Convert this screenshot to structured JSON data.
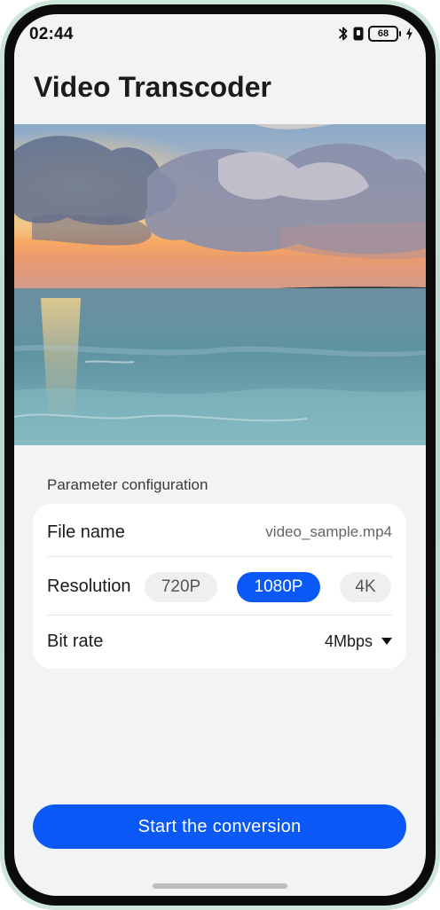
{
  "status_bar": {
    "time": "02:44",
    "battery_level": "68",
    "icons": [
      "bluetooth-icon",
      "vibrate-icon",
      "battery-icon",
      "charging-icon"
    ]
  },
  "header": {
    "title": "Video Transcoder"
  },
  "preview": {
    "icon": "sunset-ocean-video-thumbnail"
  },
  "params": {
    "section_label": "Parameter configuration",
    "file_name_label": "File name",
    "file_name_value": "video_sample.mp4",
    "resolution_label": "Resolution",
    "resolution_options": [
      "720P",
      "1080P",
      "4K"
    ],
    "resolution_selected": "1080P",
    "bit_rate_label": "Bit rate",
    "bit_rate_value": "4Mbps"
  },
  "actions": {
    "start_label": "Start the conversion"
  },
  "colors": {
    "accent": "#0a59f7",
    "background": "#f1f3f5",
    "card": "#ffffff"
  }
}
